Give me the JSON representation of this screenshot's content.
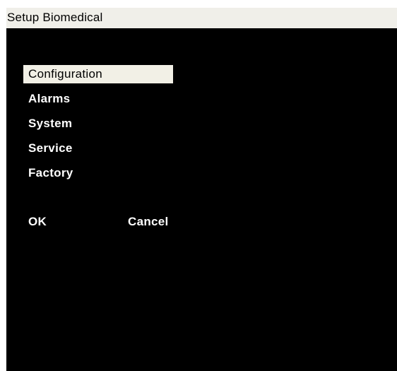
{
  "window": {
    "title": "Setup Biomedical"
  },
  "menu": {
    "items": [
      {
        "label": "Configuration",
        "selected": true
      },
      {
        "label": "Alarms",
        "selected": false
      },
      {
        "label": "System",
        "selected": false
      },
      {
        "label": "Service",
        "selected": false
      },
      {
        "label": "Factory",
        "selected": false
      }
    ]
  },
  "buttons": {
    "ok_label": "OK",
    "cancel_label": "Cancel"
  },
  "colors": {
    "background": "#000000",
    "title_bar": "#f0efe9",
    "selection": "#f2f0e6",
    "text": "#ffffff"
  }
}
